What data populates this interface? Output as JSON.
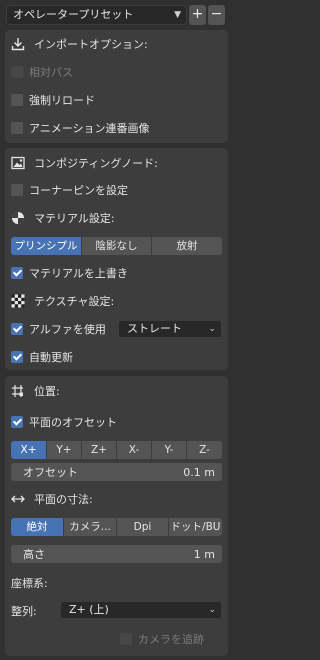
{
  "preset": {
    "selected": "オペレータープリセット",
    "add_label": "+",
    "remove_label": "−"
  },
  "import_options": {
    "title": "インポートオプション:",
    "relative_path": {
      "label": "相対パス",
      "checked": false,
      "enabled": false
    },
    "force_reload": {
      "label": "強制リロード",
      "checked": false
    },
    "image_sequence": {
      "label": "アニメーション連番画像",
      "checked": false
    }
  },
  "compositing": {
    "title": "コンポジティングノード:",
    "setup_corner_pin": {
      "label": "コーナーピンを設定",
      "checked": false
    }
  },
  "material": {
    "title": "マテリアル設定:",
    "shaders": [
      "プリンシプル",
      "陰影なし",
      "放射"
    ],
    "shader_selected": 0,
    "override": {
      "label": "マテリアルを上書き",
      "checked": true
    }
  },
  "texture": {
    "title": "テクスチャ設定:",
    "use_alpha": {
      "label": "アルファを使用",
      "checked": true
    },
    "alpha_mode": "ストレート",
    "auto_refresh": {
      "label": "自動更新",
      "checked": true
    }
  },
  "position": {
    "title": "位置:",
    "offset_planes": {
      "label": "平面のオフセット",
      "checked": true
    },
    "axes": [
      "X+",
      "Y+",
      "Z+",
      "X-",
      "Y-",
      "Z-"
    ],
    "axis_selected": 0,
    "offset": {
      "label": "オフセット",
      "value": "0.1 m"
    }
  },
  "plane_size": {
    "title": "平面の寸法:",
    "modes": [
      "絶対",
      "カメラ...",
      "Dpi",
      "ドット/BU"
    ],
    "mode_selected": 0,
    "height": {
      "label": "高さ",
      "value": "1 m"
    }
  },
  "orientation": {
    "title": "座標系:",
    "align_label": "整列:",
    "align_value": "Z+ (上)",
    "track_camera": {
      "label": "カメラを追跡",
      "checked": false,
      "enabled": false
    }
  }
}
